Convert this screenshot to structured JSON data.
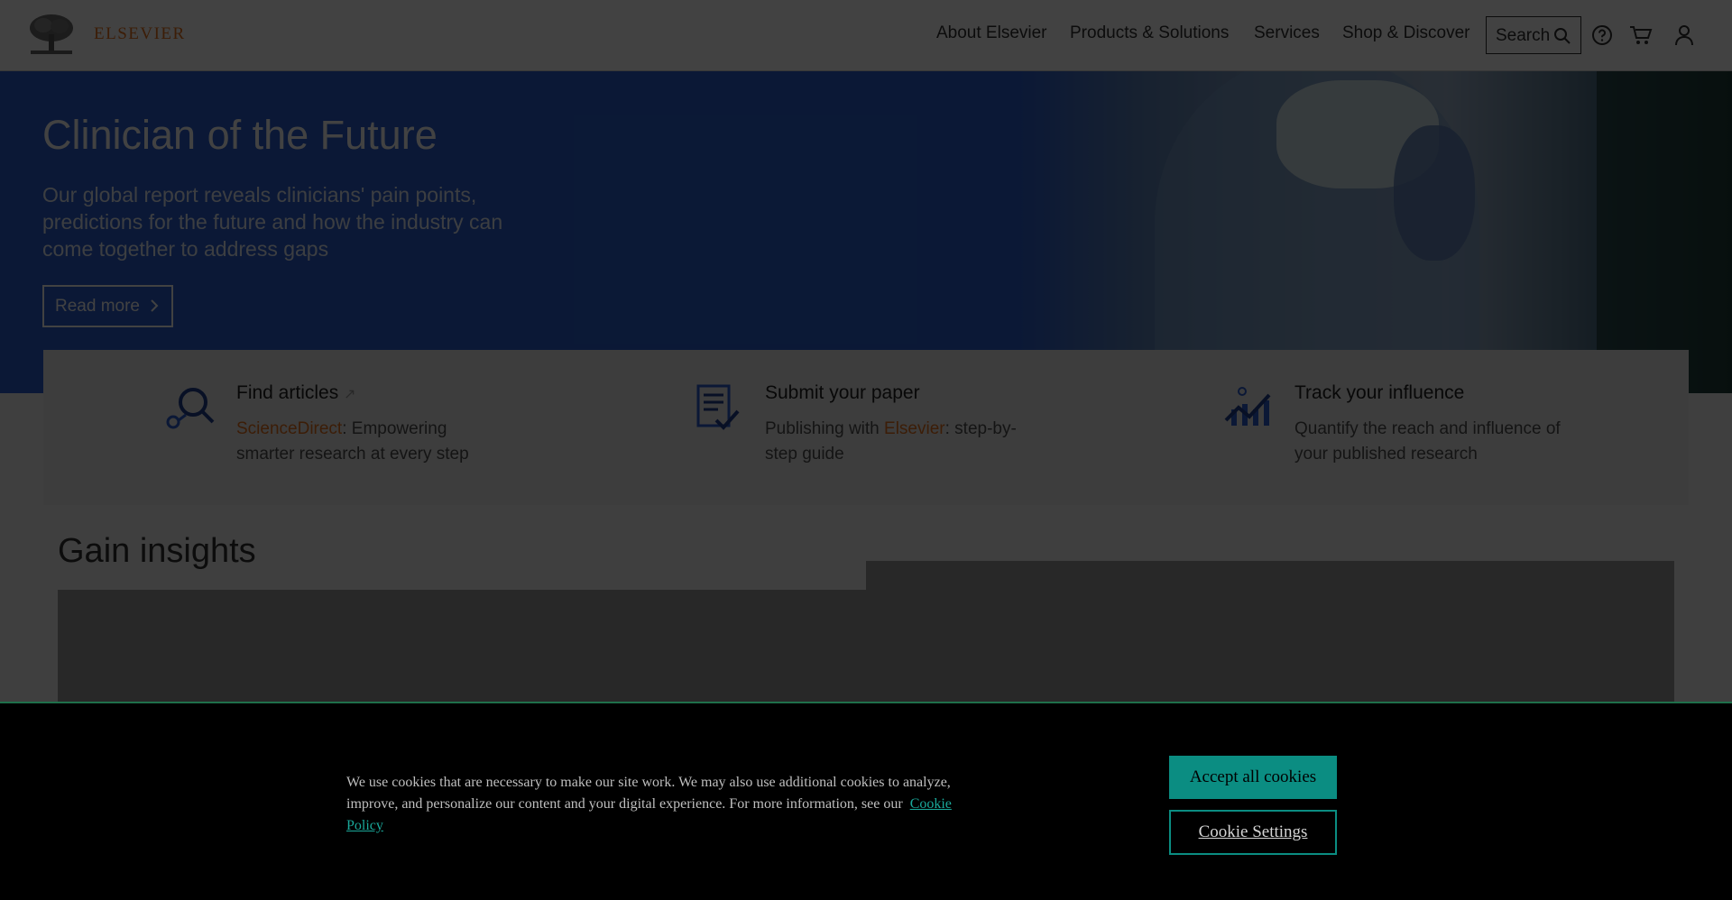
{
  "header": {
    "brand": "ELSEVIER",
    "nav": [
      "About Elsevier",
      "Products & Solutions",
      "Services",
      "Shop & Discover"
    ],
    "search_label": "Search",
    "icons": [
      "help-icon",
      "cart-icon",
      "user-icon"
    ]
  },
  "hero": {
    "title": "Clinician of the Future",
    "text": "Our global report reveals clinicians' pain points, predictions for the future and how the industry can come together to address gaps",
    "button_label": "Read more"
  },
  "cards": [
    {
      "title": "Find articles",
      "accent": "ScienceDirect",
      "desc_before": "",
      "desc_after": ": Empowering smarter research at every step",
      "icon": "magnifier-icon"
    },
    {
      "title": "Submit your paper",
      "desc_before": "Publishing with ",
      "accent": "Elsevier",
      "desc_after": ": step-by-step guide",
      "icon": "document-check-icon"
    },
    {
      "title": "Track your influence",
      "desc_before": "Quantify the reach and influence of your published research",
      "accent": "",
      "desc_after": "",
      "icon": "chart-growth-icon"
    }
  ],
  "section": {
    "title": "Gain insights"
  },
  "cookie": {
    "text": "We use cookies that are necessary to make our site work. We may also use additional cookies to analyze, improve, and personalize our content and your digital experience. For more information, see our",
    "link": "Cookie Policy",
    "accept_label": "Accept all cookies",
    "settings_label": "Cookie Settings"
  },
  "colors": {
    "brand_orange": "#e9711c",
    "hero_blue": "#2c5fcf",
    "cookie_teal": "#0b8d82"
  }
}
